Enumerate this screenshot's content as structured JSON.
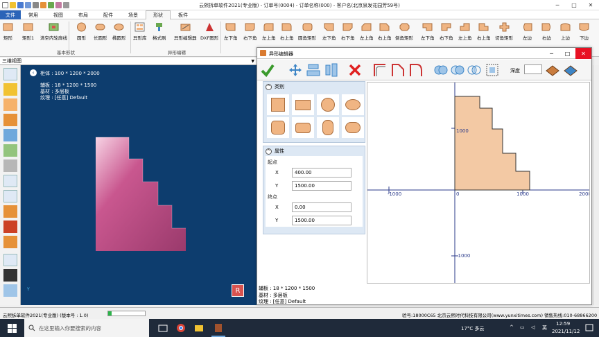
{
  "app": {
    "title": "云熙拆单软件2021(专业版) - 订单号(0004) - 订单名称(000) - 客户名(北京泉发花园芳59号)"
  },
  "tabs": [
    "文件",
    "常用",
    "视图",
    "布局",
    "配件",
    "场景",
    "形状",
    "板件"
  ],
  "ribbon": {
    "buttons": [
      "矩形",
      "矩形1",
      "清空内轮廓线",
      "圆形",
      "长圆形",
      "椭圆形",
      "异形库",
      "格式刷",
      "异形编辑器",
      "DXF图形",
      "左下角",
      "右下角",
      "左上角",
      "右上角",
      "圆角矩形",
      "左下角",
      "右下角",
      "左上角",
      "右上角",
      "倒角矩形",
      "左下角",
      "右下角",
      "左上角",
      "右上角",
      "切角矩形",
      "左边",
      "右边",
      "上边",
      "下边"
    ],
    "groups": [
      "基本形状",
      "异形编辑"
    ]
  },
  "view": {
    "header": "三维视图",
    "cabinet": "柜体 : 100 * 1200 * 2000",
    "board": "辅板 : 18 * 1200 * 1500",
    "material": "基材 : 多层板",
    "texture": "纹理 : [任意] Default",
    "axis": "Y",
    "logo": "R"
  },
  "dialog": {
    "title": "异形编辑器",
    "depth_label": "深度",
    "depth_value": "",
    "category_label": "类别",
    "properties_label": "属性",
    "start_label": "起点",
    "end_label": "终点",
    "start": {
      "x_label": "X",
      "x": "400.00",
      "y_label": "Y",
      "y": "1500.00"
    },
    "end": {
      "x_label": "X",
      "x": "0.00",
      "y_label": "Y",
      "y": "1500.00"
    },
    "footer": {
      "board": "辅板 : 18 * 1200 * 1500",
      "material": "基材 : 多层板",
      "texture": "纹理 : [任意] Default"
    },
    "axis_labels": {
      "x_neg": "-1000",
      "x_zero": "0",
      "x_1000": "1000",
      "x_2000": "2000",
      "y_1000": "1000",
      "y_neg": "-1000"
    }
  },
  "status": {
    "left": "云熙拆单软件2021(专业版) (版本号 : 1.0)",
    "progress": 0.1,
    "right": "验号:18000C65 北京云熙时代科技有限公司(www.yunxitimes.com) 销售热线:010-68866200"
  },
  "taskbar": {
    "search_placeholder": "在这里输入你要搜索的内容",
    "weather": "17°C 多云",
    "time": "12:59",
    "date": "2021/11/12",
    "lang": "英"
  },
  "colors": {
    "accent": "#2b64b8",
    "shape_fill": "#f0c7a0",
    "viewport": "#0d3d6e",
    "stairs": "#b0477e"
  }
}
